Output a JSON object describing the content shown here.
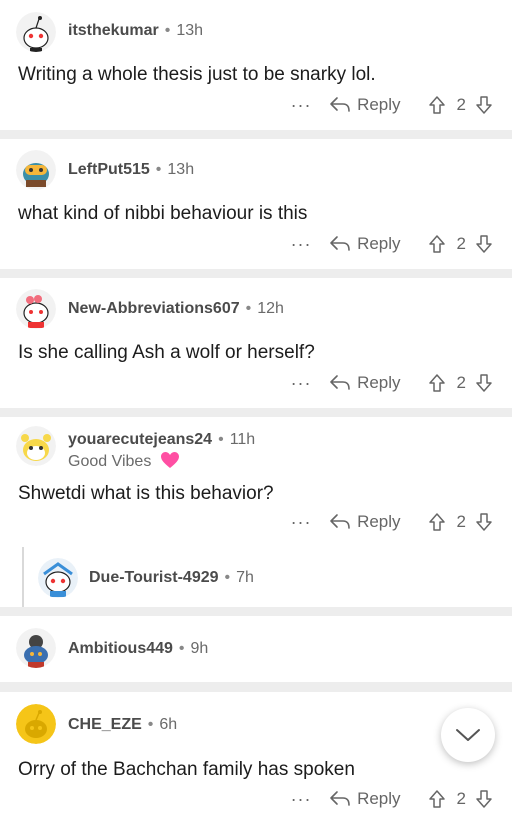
{
  "comments": [
    {
      "user": "itsthekumar",
      "time": "13h",
      "text": "Writing a whole thesis just to be snarky lol.",
      "reply_label": "Reply",
      "score": "2",
      "more": "···"
    },
    {
      "user": "LeftPut515",
      "time": "13h",
      "text": "what kind of nibbi behaviour is this",
      "reply_label": "Reply",
      "score": "2",
      "more": "···"
    },
    {
      "user": "New-Abbreviations607",
      "time": "12h",
      "text": "Is she calling Ash a wolf or herself?",
      "reply_label": "Reply",
      "score": "2",
      "more": "···"
    },
    {
      "user": "youarecutejeans24",
      "time": "11h",
      "flair": "Good Vibes",
      "text": "Shwetdi what is this behavior?",
      "reply_label": "Reply",
      "score": "2",
      "more": "···"
    },
    {
      "user": "Due-Tourist-4929",
      "time": "7h"
    },
    {
      "user": "Ambitious449",
      "time": "9h"
    },
    {
      "user": "CHE_EZE",
      "time": "6h",
      "text": "Orry of the Bachchan family has spoken",
      "reply_label": "Reply",
      "score": "2",
      "more": "···"
    }
  ],
  "separator": "•",
  "colors": {
    "background": "#ededed",
    "card": "#ffffff",
    "text": "#1c1c1c",
    "muted": "#6a6a6a",
    "flair_heart": "#ff4fa3"
  },
  "icons": {
    "reply": "reply-arrow-icon",
    "upvote": "upvote-arrow-icon",
    "downvote": "downvote-arrow-icon",
    "more": "more-dots-icon",
    "scroll": "chevron-down-icon"
  }
}
